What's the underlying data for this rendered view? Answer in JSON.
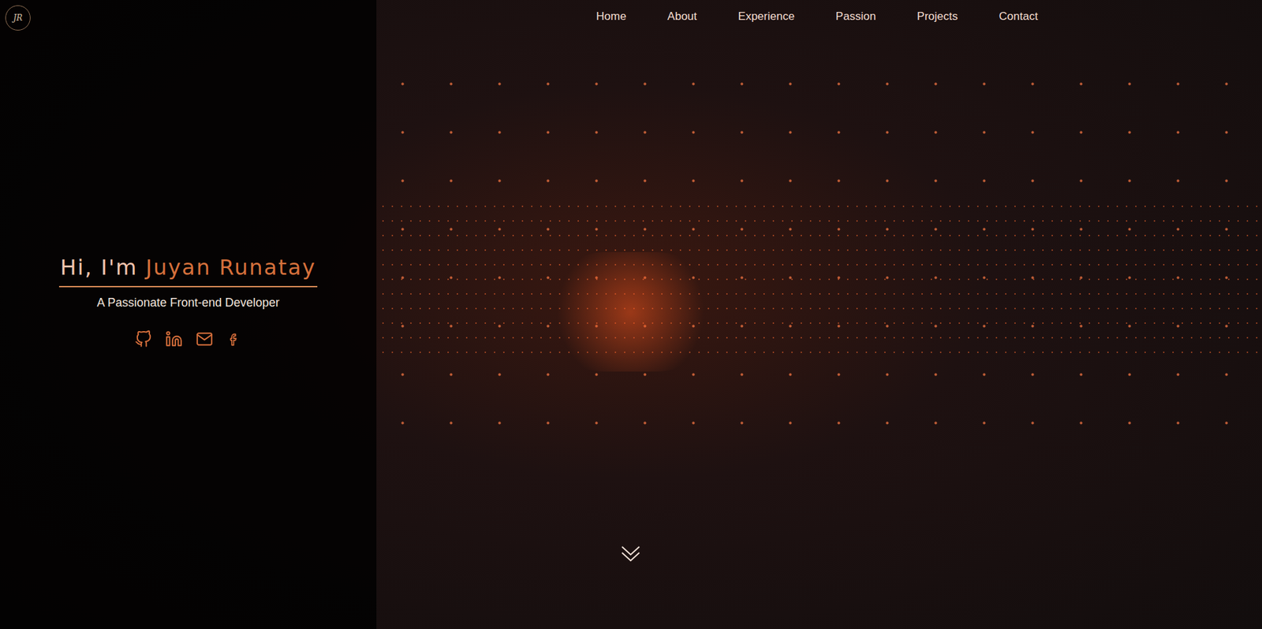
{
  "logo": {
    "text": "JR"
  },
  "nav": [
    {
      "label": "Home"
    },
    {
      "label": "About"
    },
    {
      "label": "Experience"
    },
    {
      "label": "Passion"
    },
    {
      "label": "Projects"
    },
    {
      "label": "Contact"
    }
  ],
  "hero": {
    "greeting": "Hi, I'm",
    "name": "Juyan Runatay",
    "subtitle": "A Passionate Front-end Developer"
  }
}
